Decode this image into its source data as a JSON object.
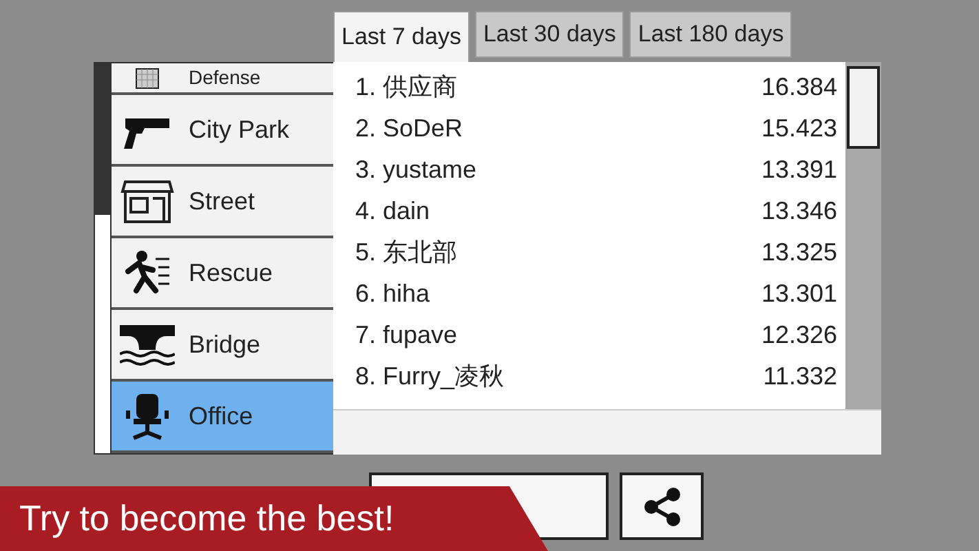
{
  "categories": [
    {
      "label": "Defense",
      "kind": "fence",
      "selected": false
    },
    {
      "label": "City Park",
      "kind": "pistol",
      "selected": false
    },
    {
      "label": "Street",
      "kind": "shop",
      "selected": false
    },
    {
      "label": "Rescue",
      "kind": "runner",
      "selected": false
    },
    {
      "label": "Bridge",
      "kind": "bridge",
      "selected": false
    },
    {
      "label": "Office",
      "kind": "chair",
      "selected": true
    }
  ],
  "tabs": [
    {
      "label": "Last 7 days",
      "selected": true
    },
    {
      "label": "Last 30 days",
      "selected": false
    },
    {
      "label": "Last 180 days",
      "selected": false
    }
  ],
  "leaderboard": [
    {
      "name": "1. 供应商",
      "score": "16.384"
    },
    {
      "name": "2. SoDeR",
      "score": "15.423"
    },
    {
      "name": "3. yustame",
      "score": "13.391"
    },
    {
      "name": "4. dain",
      "score": "13.346"
    },
    {
      "name": "5. 东北部",
      "score": "13.325"
    },
    {
      "name": "6. hiha",
      "score": "13.301"
    },
    {
      "name": "7. fupave",
      "score": "12.326"
    },
    {
      "name": "8. Furry_凌秋",
      "score": "11.332"
    }
  ],
  "banner": "Try to become the best!"
}
